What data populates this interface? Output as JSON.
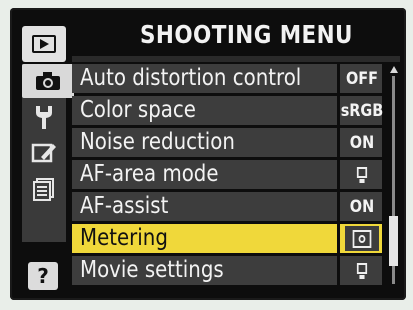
{
  "menu": {
    "title": "SHOOTING MENU",
    "items": [
      {
        "label": "Auto distortion control",
        "value": "OFF",
        "value_icon": null
      },
      {
        "label": "Color space",
        "value": "sRGB",
        "value_icon": null
      },
      {
        "label": "Noise reduction",
        "value": "ON",
        "value_icon": null
      },
      {
        "label": "AF-area mode",
        "value": "",
        "value_icon": "submenu-list-icon"
      },
      {
        "label": "AF-assist",
        "value": "ON",
        "value_icon": null
      },
      {
        "label": "Metering",
        "value": "",
        "value_icon": "matrix-metering-icon"
      },
      {
        "label": "Movie settings",
        "value": "",
        "value_icon": "submenu-list-icon"
      }
    ],
    "selected_index": 5
  },
  "sidebar": {
    "tabs": [
      {
        "name": "playback-menu-icon"
      },
      {
        "name": "shooting-menu-icon"
      },
      {
        "name": "setup-menu-icon"
      },
      {
        "name": "retouch-menu-icon"
      },
      {
        "name": "recent-settings-icon"
      }
    ],
    "active_index": 1,
    "help_label": "?"
  },
  "colors": {
    "background": "#0d0d0d",
    "row": "#3d3d3d",
    "selected_row": "#f0d83a",
    "text": "#f3f3f3"
  }
}
